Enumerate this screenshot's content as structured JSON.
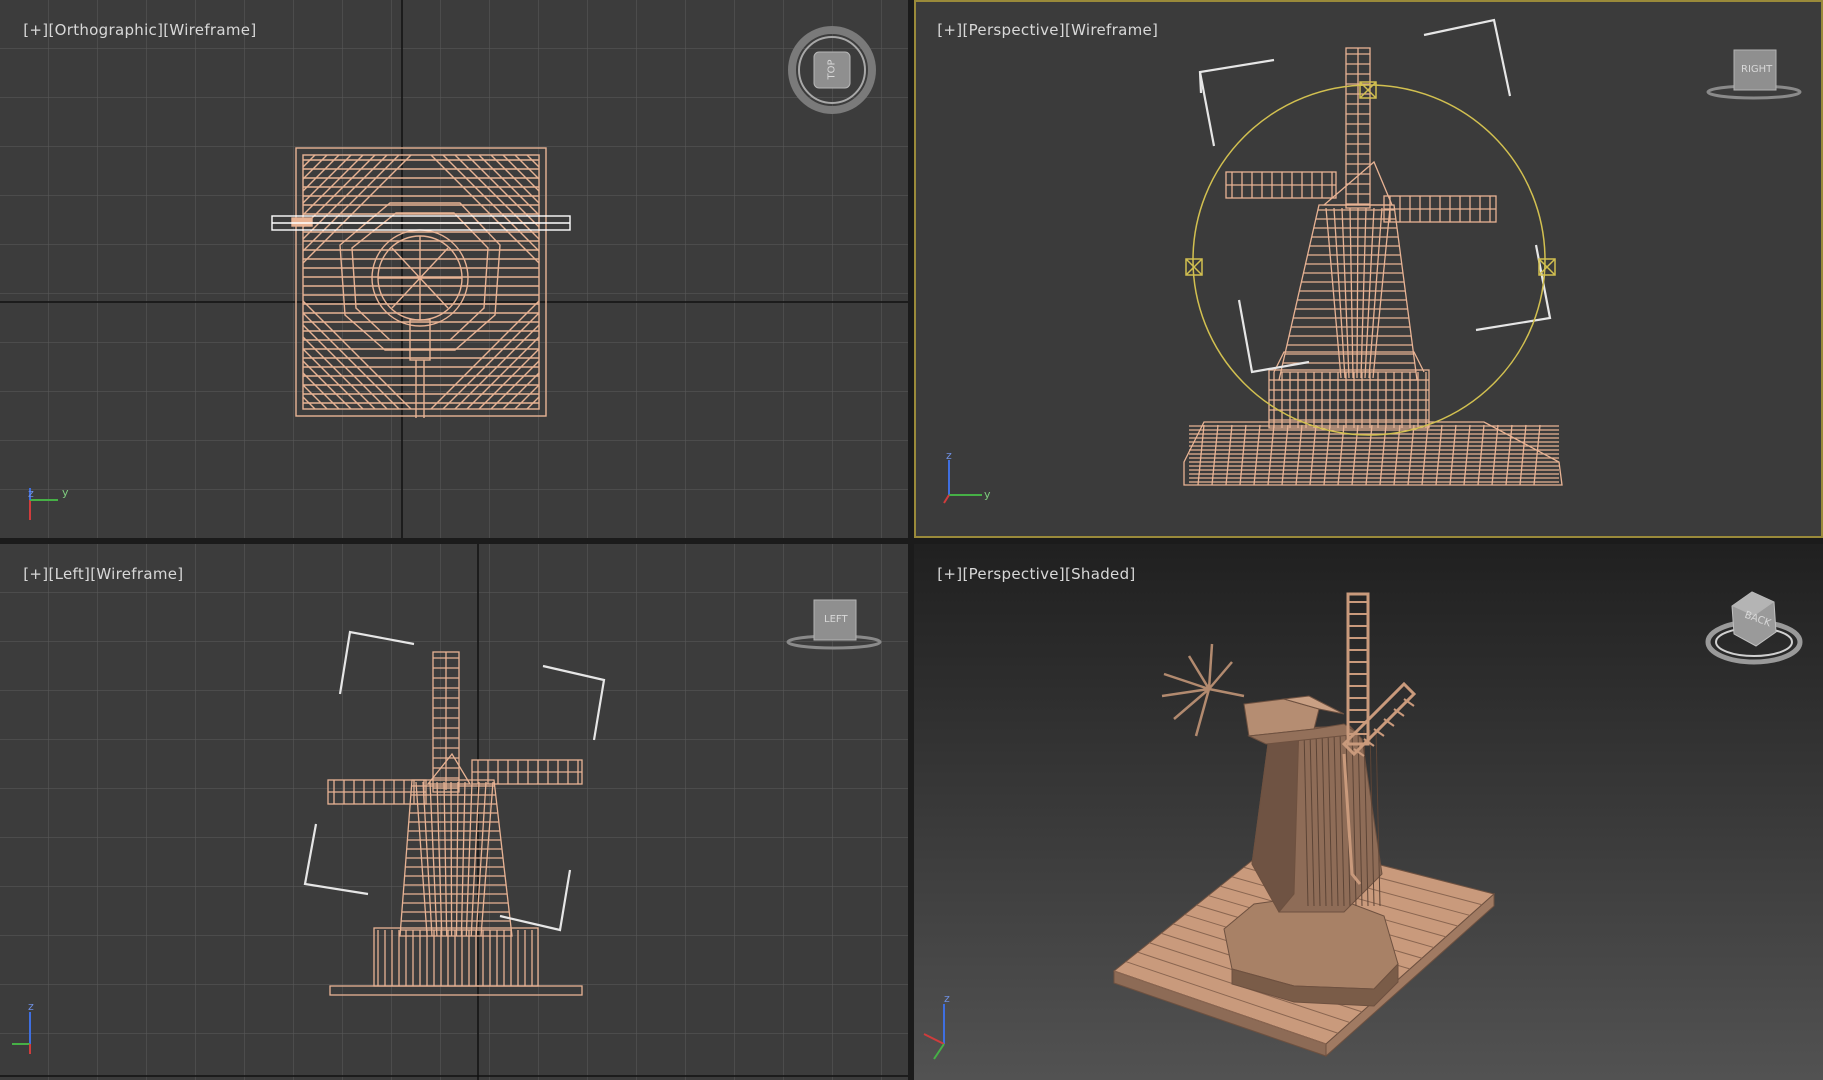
{
  "colors": {
    "grid_bg": "#3c3c3c",
    "grid_line": "#5b5b5b",
    "axis_line": "#111111",
    "wire": "#e8b394",
    "shaded": "#c99a7c",
    "gizmo": "#d2c050",
    "bracket": "#e6e6e6",
    "active_border": "#9a8a3a"
  },
  "viewports": [
    {
      "id": "top",
      "labels": [
        "[+]",
        "[Orthographic]",
        "[Wireframe]"
      ],
      "navcube_face": "TOP",
      "active": false
    },
    {
      "id": "persp_wire",
      "labels": [
        "[+]",
        "[Perspective]",
        "[Wireframe]"
      ],
      "navcube_face": "RIGHT",
      "active": true
    },
    {
      "id": "left",
      "labels": [
        "[+]",
        "[Left]",
        "[Wireframe]"
      ],
      "navcube_face": "LEFT",
      "active": false
    },
    {
      "id": "persp_shaded",
      "labels": [
        "[+]",
        "[Perspective]",
        "[Shaded]"
      ],
      "navcube_face": "BACK",
      "active": false
    }
  ],
  "axis_tripod": {
    "z": "z",
    "y": "y",
    "x": "x"
  },
  "icons": [
    "view-cube-icon",
    "axis-tripod-icon",
    "move-gizmo-icon"
  ]
}
